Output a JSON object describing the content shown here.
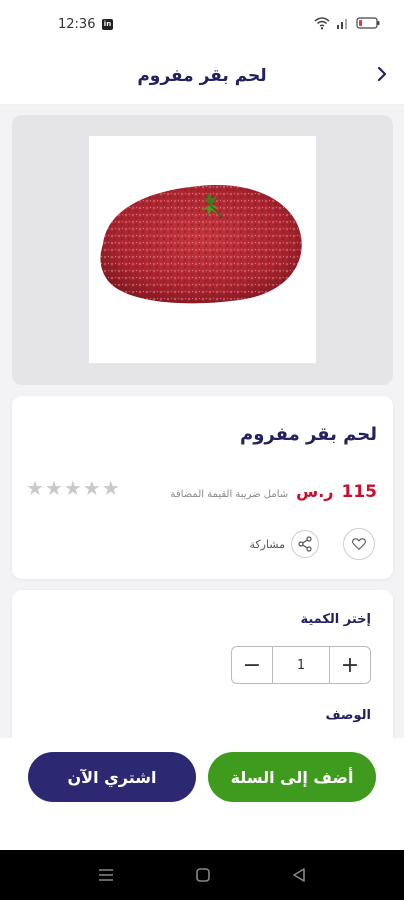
{
  "status_bar": {
    "time": "12:36",
    "app_badge": "in"
  },
  "header": {
    "title": "لحم بقر مفروم"
  },
  "product": {
    "title": "لحم بقر مفروم",
    "price": "115",
    "currency": "ر.س",
    "vat_note": "شامل ضريبة القيمة المضافة",
    "rating": 0,
    "rating_max": 5,
    "share_label": "مشاركة"
  },
  "quantity": {
    "label": "إختر الكمية",
    "value": "1",
    "minus": "−",
    "plus": "+"
  },
  "description": {
    "label": "الوصف"
  },
  "actions": {
    "add_to_cart": "أضف إلى السلة",
    "buy_now": "اشتري الآن"
  },
  "colors": {
    "primary": "#2c2872",
    "accent_green": "#3f9b1e",
    "price_red": "#c8102e"
  }
}
